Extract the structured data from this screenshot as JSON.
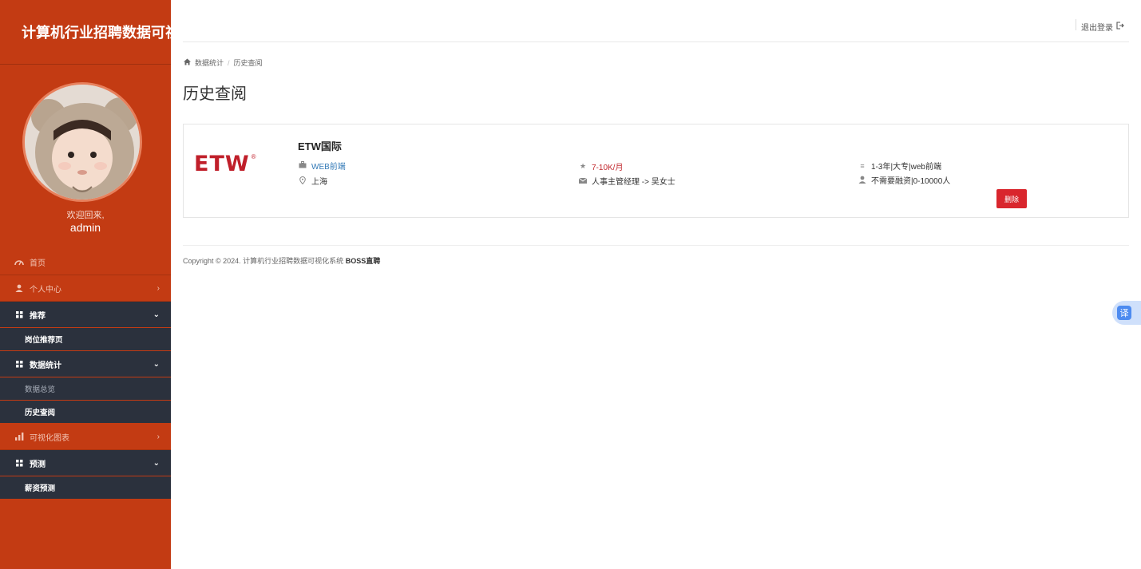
{
  "sidebar": {
    "brand": "计算机行业招聘数据可视化",
    "welcome": "欢迎回来,",
    "username": "admin",
    "menu": {
      "home": "首页",
      "profile": "个人中心",
      "recommend": "推荐",
      "recommend_page": "岗位推荐页",
      "stats": "数据统计",
      "stats_overview": "数据总览",
      "history": "历史查阅",
      "charts": "可视化图表",
      "predict": "预测",
      "salary_predict": "薪资预测"
    }
  },
  "header": {
    "logout": "退出登录"
  },
  "breadcrumb": {
    "home": "数据统计",
    "current": "历史查阅"
  },
  "page_title": "历史查阅",
  "record": {
    "logo": "ETW",
    "logo_mark": "®",
    "company": "ETW国际",
    "job_title": "WEB前端",
    "city": "上海",
    "salary": "7-10K/月",
    "hr": "人事主管经理 -> 吴女士",
    "requirement": "1-3年|大专|web前端",
    "company_info": "不需要融资|0-10000人",
    "delete_label": "删除"
  },
  "footer": {
    "copyright": "Copyright © 2024. 计算机行业招聘数据可视化系统",
    "brand": "BOSS直聘"
  },
  "translate": "译",
  "colors": {
    "sidebar": "#c33b13",
    "submenu": "#2b313d",
    "danger": "#d9262d",
    "link": "#337ab7"
  }
}
